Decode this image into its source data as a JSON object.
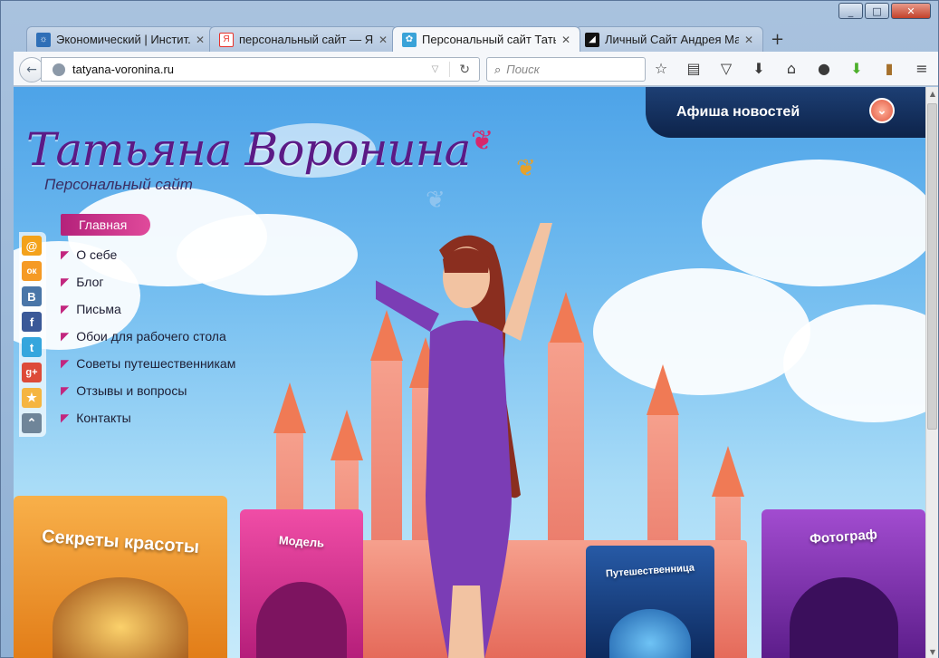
{
  "browser": {
    "tabs": [
      {
        "title": "Экономический | Инстит...",
        "favicon_color": "#2f6fb7",
        "active": false
      },
      {
        "title": "персональный сайт — Я...",
        "favicon_color": "#e8322a",
        "active": false
      },
      {
        "title": "Персональный сайт Тать...",
        "favicon_color": "#3aa3d8",
        "active": true
      },
      {
        "title": "Личный Сайт Андрея Ма...",
        "favicon_color": "#111111",
        "active": false
      }
    ],
    "new_tab": "+",
    "url": "tatyana-voronina.ru",
    "search_placeholder": "Поиск",
    "toolbar_icons": [
      "bookmark-star-icon",
      "reader-icon",
      "pocket-icon",
      "download-icon",
      "home-icon",
      "chat-icon",
      "addon-download-icon",
      "bookmark-folder-icon",
      "menu-icon"
    ]
  },
  "site": {
    "title": "Татьяна Воронина",
    "subtitle": "Персональный сайт",
    "news_button": "Афиша новостей",
    "menu_active": "Главная",
    "menu": [
      "О себе",
      "Блог",
      "Письма",
      "Обои для рабочего стола",
      "Советы путешественникам",
      "Отзывы и вопросы",
      "Контакты"
    ],
    "social": [
      {
        "name": "mail-icon",
        "glyph": "@",
        "color": "#f3a21b"
      },
      {
        "name": "odnoklassniki-icon",
        "glyph": "ок",
        "color": "#f59a24"
      },
      {
        "name": "vkontakte-icon",
        "glyph": "В",
        "color": "#4a76a8"
      },
      {
        "name": "facebook-icon",
        "glyph": "f",
        "color": "#3b5998"
      },
      {
        "name": "twitter-icon",
        "glyph": "t",
        "color": "#35a6dd"
      },
      {
        "name": "google-plus-icon",
        "glyph": "g+",
        "color": "#dd4b39"
      },
      {
        "name": "favorites-icon",
        "glyph": "★",
        "color": "#f5b540"
      },
      {
        "name": "scroll-top-icon",
        "glyph": "⌃",
        "color": "#6f8599"
      }
    ],
    "cards": [
      {
        "label": "Секреты красоты",
        "color": "#f59a2a"
      },
      {
        "label": "Модель",
        "color": "#d9358c"
      },
      {
        "label": "Путешественница",
        "color": "#1f4f93"
      },
      {
        "label": "Фотограф",
        "color": "#8a3cb5"
      }
    ]
  }
}
